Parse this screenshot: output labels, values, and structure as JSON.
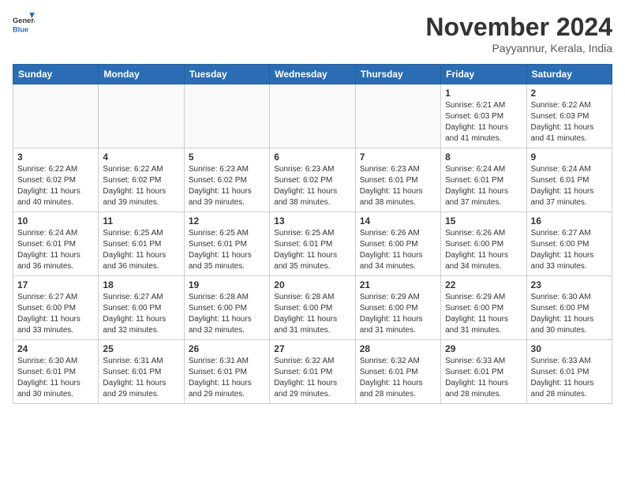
{
  "header": {
    "logo_general": "General",
    "logo_blue": "Blue",
    "month_title": "November 2024",
    "location": "Payyannur, Kerala, India"
  },
  "weekdays": [
    "Sunday",
    "Monday",
    "Tuesday",
    "Wednesday",
    "Thursday",
    "Friday",
    "Saturday"
  ],
  "weeks": [
    [
      {
        "day": "",
        "text": ""
      },
      {
        "day": "",
        "text": ""
      },
      {
        "day": "",
        "text": ""
      },
      {
        "day": "",
        "text": ""
      },
      {
        "day": "",
        "text": ""
      },
      {
        "day": "1",
        "text": "Sunrise: 6:21 AM\nSunset: 6:03 PM\nDaylight: 11 hours\nand 41 minutes."
      },
      {
        "day": "2",
        "text": "Sunrise: 6:22 AM\nSunset: 6:03 PM\nDaylight: 11 hours\nand 41 minutes."
      }
    ],
    [
      {
        "day": "3",
        "text": "Sunrise: 6:22 AM\nSunset: 6:02 PM\nDaylight: 11 hours\nand 40 minutes."
      },
      {
        "day": "4",
        "text": "Sunrise: 6:22 AM\nSunset: 6:02 PM\nDaylight: 11 hours\nand 39 minutes."
      },
      {
        "day": "5",
        "text": "Sunrise: 6:23 AM\nSunset: 6:02 PM\nDaylight: 11 hours\nand 39 minutes."
      },
      {
        "day": "6",
        "text": "Sunrise: 6:23 AM\nSunset: 6:02 PM\nDaylight: 11 hours\nand 38 minutes."
      },
      {
        "day": "7",
        "text": "Sunrise: 6:23 AM\nSunset: 6:01 PM\nDaylight: 11 hours\nand 38 minutes."
      },
      {
        "day": "8",
        "text": "Sunrise: 6:24 AM\nSunset: 6:01 PM\nDaylight: 11 hours\nand 37 minutes."
      },
      {
        "day": "9",
        "text": "Sunrise: 6:24 AM\nSunset: 6:01 PM\nDaylight: 11 hours\nand 37 minutes."
      }
    ],
    [
      {
        "day": "10",
        "text": "Sunrise: 6:24 AM\nSunset: 6:01 PM\nDaylight: 11 hours\nand 36 minutes."
      },
      {
        "day": "11",
        "text": "Sunrise: 6:25 AM\nSunset: 6:01 PM\nDaylight: 11 hours\nand 36 minutes."
      },
      {
        "day": "12",
        "text": "Sunrise: 6:25 AM\nSunset: 6:01 PM\nDaylight: 11 hours\nand 35 minutes."
      },
      {
        "day": "13",
        "text": "Sunrise: 6:25 AM\nSunset: 6:01 PM\nDaylight: 11 hours\nand 35 minutes."
      },
      {
        "day": "14",
        "text": "Sunrise: 6:26 AM\nSunset: 6:00 PM\nDaylight: 11 hours\nand 34 minutes."
      },
      {
        "day": "15",
        "text": "Sunrise: 6:26 AM\nSunset: 6:00 PM\nDaylight: 11 hours\nand 34 minutes."
      },
      {
        "day": "16",
        "text": "Sunrise: 6:27 AM\nSunset: 6:00 PM\nDaylight: 11 hours\nand 33 minutes."
      }
    ],
    [
      {
        "day": "17",
        "text": "Sunrise: 6:27 AM\nSunset: 6:00 PM\nDaylight: 11 hours\nand 33 minutes."
      },
      {
        "day": "18",
        "text": "Sunrise: 6:27 AM\nSunset: 6:00 PM\nDaylight: 11 hours\nand 32 minutes."
      },
      {
        "day": "19",
        "text": "Sunrise: 6:28 AM\nSunset: 6:00 PM\nDaylight: 11 hours\nand 32 minutes."
      },
      {
        "day": "20",
        "text": "Sunrise: 6:28 AM\nSunset: 6:00 PM\nDaylight: 11 hours\nand 31 minutes."
      },
      {
        "day": "21",
        "text": "Sunrise: 6:29 AM\nSunset: 6:00 PM\nDaylight: 11 hours\nand 31 minutes."
      },
      {
        "day": "22",
        "text": "Sunrise: 6:29 AM\nSunset: 6:00 PM\nDaylight: 11 hours\nand 31 minutes."
      },
      {
        "day": "23",
        "text": "Sunrise: 6:30 AM\nSunset: 6:00 PM\nDaylight: 11 hours\nand 30 minutes."
      }
    ],
    [
      {
        "day": "24",
        "text": "Sunrise: 6:30 AM\nSunset: 6:01 PM\nDaylight: 11 hours\nand 30 minutes."
      },
      {
        "day": "25",
        "text": "Sunrise: 6:31 AM\nSunset: 6:01 PM\nDaylight: 11 hours\nand 29 minutes."
      },
      {
        "day": "26",
        "text": "Sunrise: 6:31 AM\nSunset: 6:01 PM\nDaylight: 11 hours\nand 29 minutes."
      },
      {
        "day": "27",
        "text": "Sunrise: 6:32 AM\nSunset: 6:01 PM\nDaylight: 11 hours\nand 29 minutes."
      },
      {
        "day": "28",
        "text": "Sunrise: 6:32 AM\nSunset: 6:01 PM\nDaylight: 11 hours\nand 28 minutes."
      },
      {
        "day": "29",
        "text": "Sunrise: 6:33 AM\nSunset: 6:01 PM\nDaylight: 11 hours\nand 28 minutes."
      },
      {
        "day": "30",
        "text": "Sunrise: 6:33 AM\nSunset: 6:01 PM\nDaylight: 11 hours\nand 28 minutes."
      }
    ]
  ]
}
